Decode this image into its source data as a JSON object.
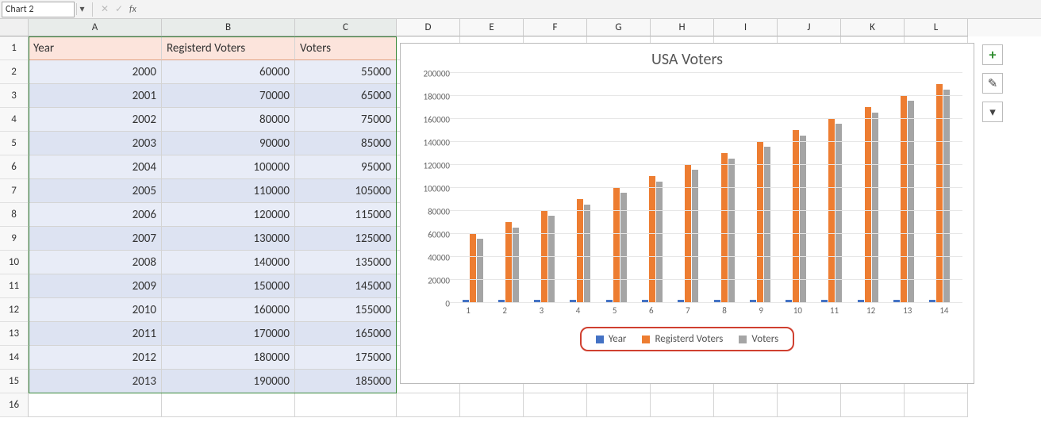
{
  "formula_bar": {
    "name_box": "Chart 2",
    "fx_label": "fx"
  },
  "columns": [
    "A",
    "B",
    "C",
    "D",
    "E",
    "F",
    "G",
    "H",
    "I",
    "J",
    "K",
    "L"
  ],
  "table": {
    "headers": [
      "Year",
      "Registerd Voters",
      "Voters"
    ],
    "rows": [
      {
        "year": "2000",
        "rv": "60000",
        "v": "55000"
      },
      {
        "year": "2001",
        "rv": "70000",
        "v": "65000"
      },
      {
        "year": "2002",
        "rv": "80000",
        "v": "75000"
      },
      {
        "year": "2003",
        "rv": "90000",
        "v": "85000"
      },
      {
        "year": "2004",
        "rv": "100000",
        "v": "95000"
      },
      {
        "year": "2005",
        "rv": "110000",
        "v": "105000"
      },
      {
        "year": "2006",
        "rv": "120000",
        "v": "115000"
      },
      {
        "year": "2007",
        "rv": "130000",
        "v": "125000"
      },
      {
        "year": "2008",
        "rv": "140000",
        "v": "135000"
      },
      {
        "year": "2009",
        "rv": "150000",
        "v": "145000"
      },
      {
        "year": "2010",
        "rv": "160000",
        "v": "155000"
      },
      {
        "year": "2011",
        "rv": "170000",
        "v": "165000"
      },
      {
        "year": "2012",
        "rv": "180000",
        "v": "175000"
      },
      {
        "year": "2013",
        "rv": "190000",
        "v": "185000"
      }
    ]
  },
  "chart_data": {
    "type": "bar",
    "title": "USA Voters",
    "xlabel": "",
    "ylabel": "",
    "ylim": [
      0,
      200000
    ],
    "y_ticks": [
      0,
      20000,
      40000,
      60000,
      80000,
      100000,
      120000,
      140000,
      160000,
      180000,
      200000
    ],
    "categories": [
      1,
      2,
      3,
      4,
      5,
      6,
      7,
      8,
      9,
      10,
      11,
      12,
      13,
      14
    ],
    "series": [
      {
        "name": "Year",
        "color": "#4472c4",
        "values": [
          2000,
          2001,
          2002,
          2003,
          2004,
          2005,
          2006,
          2007,
          2008,
          2009,
          2010,
          2011,
          2012,
          2013
        ]
      },
      {
        "name": "Registerd Voters",
        "color": "#ed7d31",
        "values": [
          60000,
          70000,
          80000,
          90000,
          100000,
          110000,
          120000,
          130000,
          140000,
          150000,
          160000,
          170000,
          180000,
          190000
        ]
      },
      {
        "name": "Voters",
        "color": "#a5a5a5",
        "values": [
          55000,
          65000,
          75000,
          85000,
          95000,
          105000,
          115000,
          125000,
          135000,
          145000,
          155000,
          165000,
          175000,
          185000
        ]
      }
    ],
    "legend_position": "bottom",
    "legend_highlighted": true
  },
  "side_buttons": {
    "add": "+",
    "brush": "✎",
    "filter": "▾"
  },
  "row_count": 16
}
